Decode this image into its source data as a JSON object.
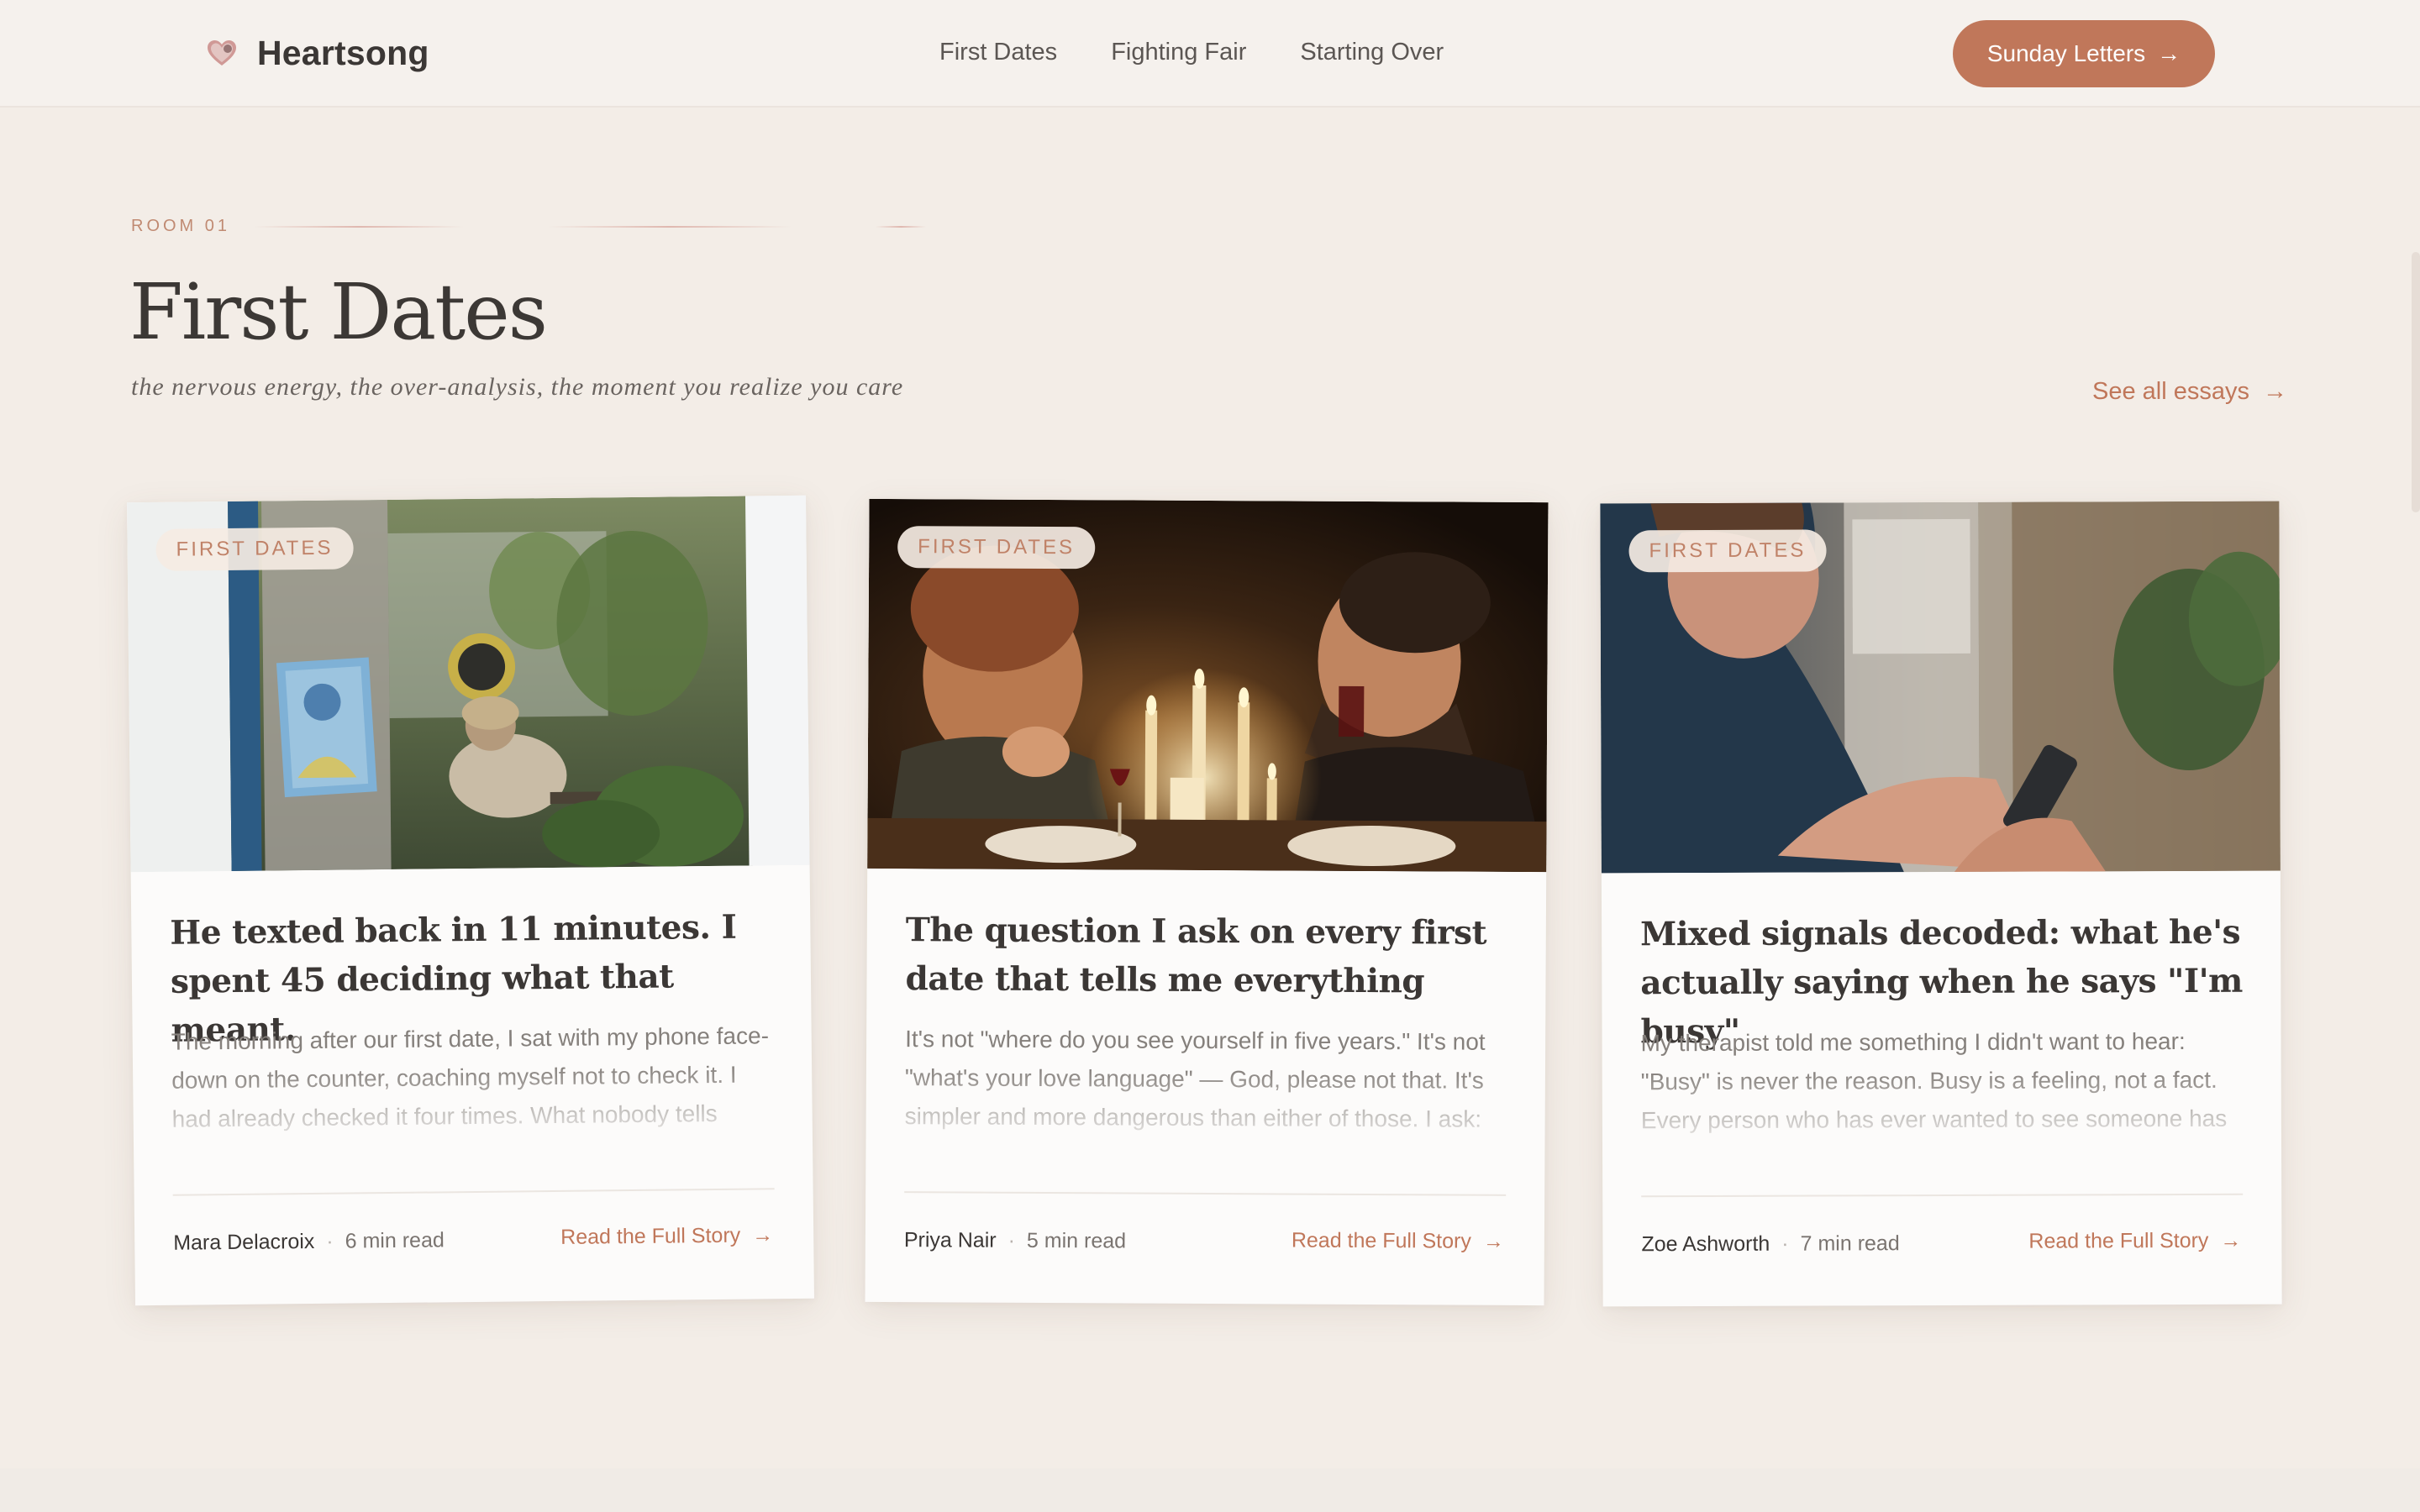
{
  "brand": {
    "name": "Heartsong",
    "logo_icon": "heart-icon",
    "accent": "#c0775a"
  },
  "nav": {
    "items": [
      {
        "label": "First Dates"
      },
      {
        "label": "Fighting Fair"
      },
      {
        "label": "Starting Over"
      }
    ]
  },
  "header": {
    "cta_label": "Sunday Letters",
    "cta_icon": "arrow-right-icon"
  },
  "section": {
    "room_label": "ROOM 01",
    "title": "First Dates",
    "subtitle": "the nervous energy, the over-analysis, the moment you realize you care",
    "see_all_label": "See all essays"
  },
  "cards": [
    {
      "tag": "FIRST DATES",
      "title": "He texted back in 11 minutes. I spent 45 deciding what that meant.",
      "excerpt": "The morning after our first date, I sat with my phone face-down on the counter, coaching myself not to check it. I had already checked it four times. What nobody tells",
      "author": "Mara Delacroix",
      "read_time": "6 min read",
      "cta": "Read the Full Story"
    },
    {
      "tag": "FIRST DATES",
      "title": "The question I ask on every first date that tells me everything",
      "excerpt": "It's not \"where do you see yourself in five years.\" It's not \"what's your love language\" — God, please not that. It's simpler and more dangerous than either of those. I ask:",
      "author": "Priya Nair",
      "read_time": "5 min read",
      "cta": "Read the Full Story"
    },
    {
      "tag": "FIRST DATES",
      "title": "Mixed signals decoded: what he's actually saying when he says \"I'm busy\"",
      "excerpt": "My therapist told me something I didn't want to hear: \"Busy\" is never the reason. Busy is a feeling, not a fact. Every person who has ever wanted to see someone has",
      "author": "Zoe Ashworth",
      "read_time": "7 min read",
      "cta": "Read the Full Story"
    }
  ],
  "meta_separator": "·",
  "arrow": "→"
}
